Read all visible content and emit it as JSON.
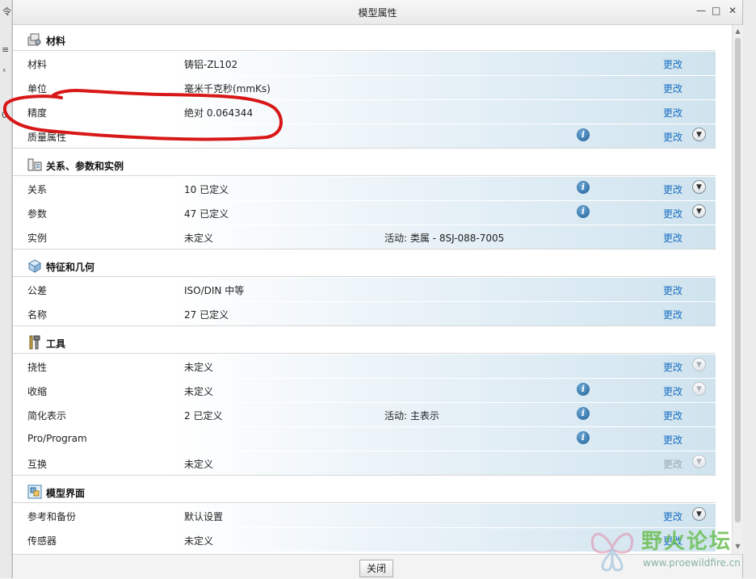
{
  "window": {
    "title": "模型属性",
    "controls": {
      "minimize": "—",
      "maximize": "□",
      "close": "✕"
    }
  },
  "background": {
    "left_fragments": [
      "令",
      "≡",
      "‹",
      "0"
    ]
  },
  "sections": {
    "material": {
      "title": "材料",
      "icon": "material-icon"
    },
    "relations": {
      "title": "关系、参数和实例",
      "icon": "relations-icon"
    },
    "features": {
      "title": "特征和几何",
      "icon": "features-icon"
    },
    "tools": {
      "title": "工具",
      "icon": "tools-icon"
    },
    "interface": {
      "title": "模型界面",
      "icon": "interface-icon"
    }
  },
  "rows": {
    "material": {
      "label": "材料",
      "value": "铸铝-ZL102",
      "change": "更改"
    },
    "units": {
      "label": "单位",
      "value": "毫米千克秒(mmKs)",
      "change": "更改"
    },
    "accuracy": {
      "label": "精度",
      "value": "绝对 0.064344",
      "change": "更改"
    },
    "mass": {
      "label": "质量属性",
      "value": "",
      "change": "更改"
    },
    "relations": {
      "label": "关系",
      "value": "10 已定义",
      "change": "更改"
    },
    "parameters": {
      "label": "参数",
      "value": "47 已定义",
      "change": "更改"
    },
    "instances": {
      "label": "实例",
      "value": "未定义",
      "active": "活动: 类属 - 8SJ-088-7005",
      "change": "更改"
    },
    "tolerance": {
      "label": "公差",
      "value": "ISO/DIN 中等",
      "change": "更改"
    },
    "names": {
      "label": "名称",
      "value": "27 已定义",
      "change": "更改"
    },
    "flexibility": {
      "label": "挠性",
      "value": "未定义",
      "change": "更改"
    },
    "shrinkage": {
      "label": "收缩",
      "value": "未定义",
      "change": "更改"
    },
    "simplified": {
      "label": "简化表示",
      "value": "2 已定义",
      "active": "活动: 主表示",
      "change": "更改"
    },
    "proprogram": {
      "label": "Pro/Program",
      "value": "",
      "change": "更改"
    },
    "interchange": {
      "label": "互换",
      "value": "未定义",
      "change": "更改"
    },
    "references": {
      "label": "参考和备份",
      "value": "默认设置",
      "change": "更改"
    },
    "sensors": {
      "label": "传感器",
      "value": "未定义",
      "change": "更改"
    }
  },
  "footer": {
    "close_label": "关闭"
  },
  "watermark": {
    "text": "野火论坛",
    "url": "www.proewildfire.cn"
  },
  "colors": {
    "link": "#1a6fc2",
    "link_disabled": "#9aa7b2",
    "band": "#cfe3ee",
    "annotation": "#d81818",
    "watermark_green": "#6cbf54"
  }
}
